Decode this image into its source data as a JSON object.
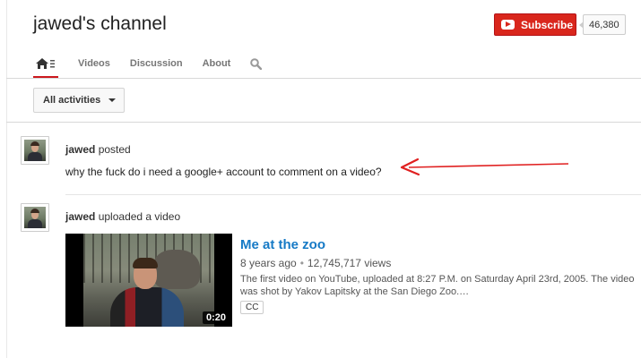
{
  "header": {
    "channel_title": "jawed's channel",
    "subscribe_label": "Subscribe",
    "subscriber_count": "46,380"
  },
  "tabs": [
    {
      "label": "Videos"
    },
    {
      "label": "Discussion"
    },
    {
      "label": "About"
    }
  ],
  "filter": {
    "label": "All activities"
  },
  "feed": {
    "post": {
      "author": "jawed",
      "action": "posted",
      "text": "why the fuck do i need a google+ account to comment on a video?"
    },
    "upload": {
      "author": "jawed",
      "action": "uploaded a video",
      "video": {
        "title": "Me at the zoo",
        "age": "8 years ago",
        "separator": "•",
        "views": "12,745,717 views",
        "description": "The first video on YouTube, uploaded at 8:27 P.M. on Saturday April 23rd, 2005. The video was shot by Yakov Lapitsky at the San Diego Zoo.…",
        "duration": "0:20",
        "badge": "CC"
      }
    }
  },
  "colors": {
    "subscribe_red": "#d9261c",
    "active_tab_underline": "#cc181e",
    "link_blue": "#167ac6",
    "annotation_arrow": "#e02020"
  },
  "icons": {
    "home_tab": "home-icon",
    "search_tab": "search-icon",
    "filter_caret": "caret-down-icon",
    "annotation": "arrow-annotation-icon"
  }
}
